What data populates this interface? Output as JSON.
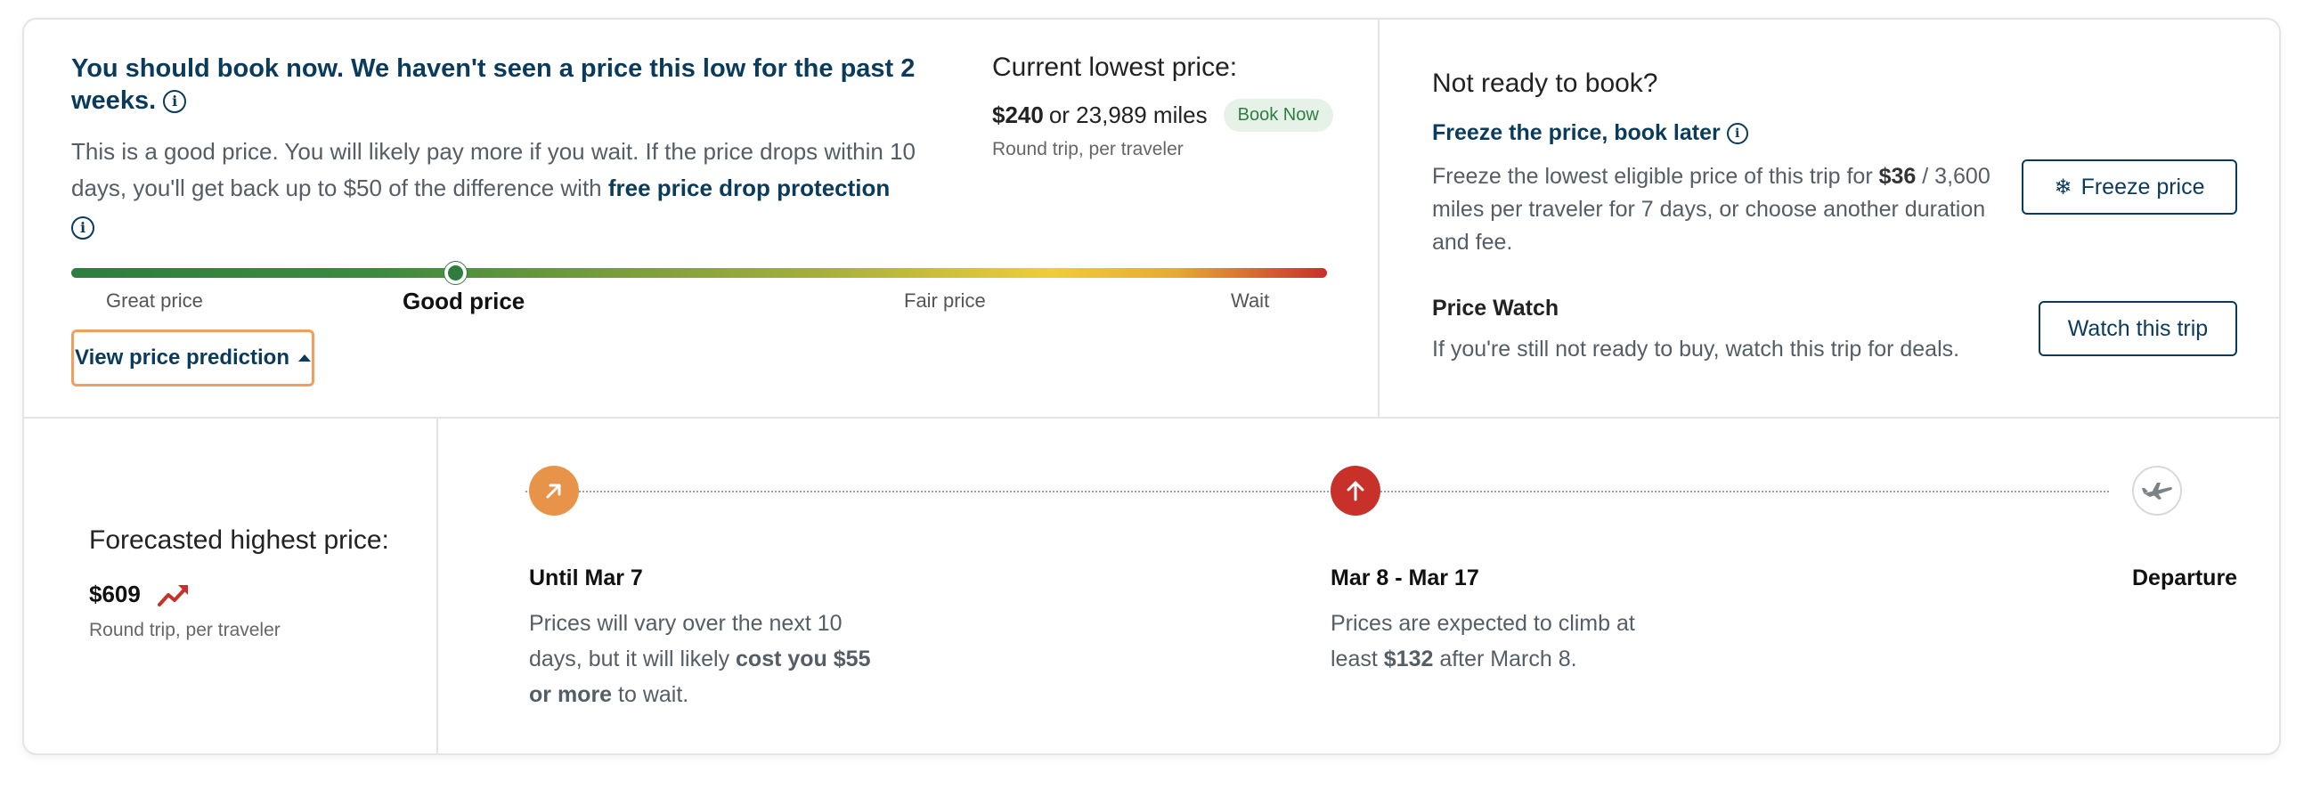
{
  "recommendation": {
    "headline": "You should book now. We haven't seen a price this low for the past 2 weeks.",
    "description_pre": "This is a good price. You will likely pay more if you wait. If the price drops within 10 days, you'll get back up to $50 of the difference with ",
    "description_link": "free price drop protection"
  },
  "current_price": {
    "label": "Current lowest price:",
    "price": "$240",
    "miles": "or 23,989 miles",
    "badge": "Book Now",
    "sub": "Round trip, per traveler"
  },
  "price_bar": {
    "labels": [
      "Great price",
      "Good price",
      "Fair price",
      "Wait"
    ],
    "active_index": 1,
    "position_fraction": 0.306,
    "colors": [
      "#2f7d3e",
      "#6e9a3a",
      "#efcd3a",
      "#c8302a"
    ]
  },
  "prediction_button": {
    "label": "View price prediction"
  },
  "not_ready": {
    "title": "Not ready to book?",
    "freeze": {
      "title": "Freeze the price, book later",
      "desc_pre": "Freeze the lowest eligible price of this trip for ",
      "desc_bold": "$36",
      "desc_post": " / 3,600 miles per traveler for 7 days, or choose another duration and fee.",
      "button": "Freeze price"
    },
    "watch": {
      "title": "Price Watch",
      "desc": "If you're still not ready to buy, watch this trip for deals.",
      "button": "Watch this trip"
    }
  },
  "forecast": {
    "title": "Forecasted highest price:",
    "price": "$609",
    "sub": "Round trip, per traveler"
  },
  "timeline": [
    {
      "heading": "Until Mar 7",
      "desc_pre": "Prices will vary over the next 10 days, but it will likely ",
      "desc_bold": "cost you $55 or more",
      "desc_post": " to wait.",
      "icon": "arrow-up-right-icon",
      "color": "#e8934a"
    },
    {
      "heading": "Mar 8 - Mar 17",
      "desc_pre": "Prices are expected to climb at least ",
      "desc_bold": "$132",
      "desc_post": " after March 8.",
      "icon": "arrow-up-icon",
      "color": "#c8302a"
    },
    {
      "heading": "Departure",
      "icon": "airplane-icon",
      "color": "#9aa0a6"
    }
  ]
}
